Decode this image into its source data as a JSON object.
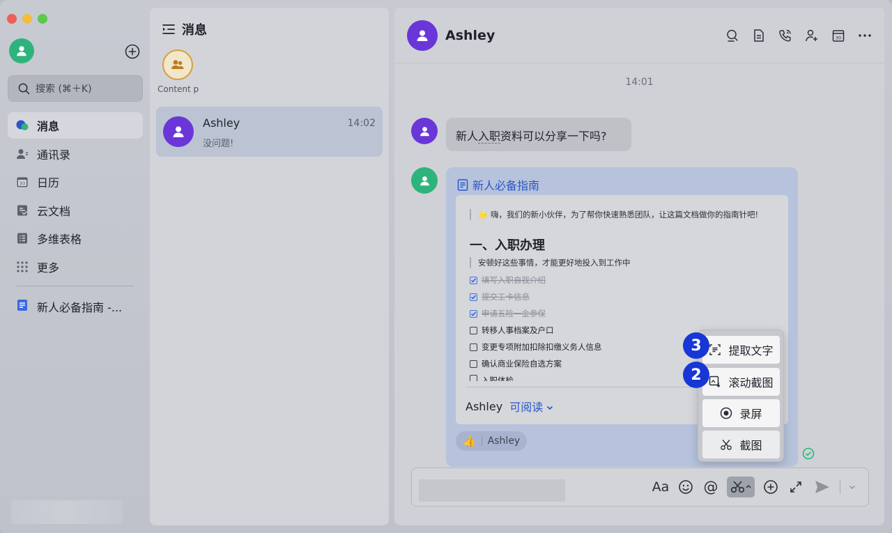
{
  "sidebar": {
    "search_placeholder": "搜索 (⌘＋K)",
    "nav": [
      {
        "label": "消息",
        "icon": "message-bubble-icon",
        "active": true
      },
      {
        "label": "通讯录",
        "icon": "contacts-icon",
        "active": false
      },
      {
        "label": "日历",
        "icon": "calendar-icon",
        "active": false
      },
      {
        "label": "云文档",
        "icon": "cloud-doc-icon",
        "active": false
      },
      {
        "label": "多维表格",
        "icon": "base-table-icon",
        "active": false
      },
      {
        "label": "更多",
        "icon": "grid-dots-icon",
        "active": false
      }
    ],
    "pinned_doc": "新人必备指南 -..."
  },
  "chat_list": {
    "title": "消息",
    "group_label": "Content p",
    "items": [
      {
        "name": "Ashley",
        "time": "14:02",
        "preview": "没问题!"
      }
    ]
  },
  "chat": {
    "title": "Ashley",
    "timestamp": "14:01",
    "message_prefix": "新人",
    "message_underlined": "入职",
    "message_suffix": "资料可以分享一下吗?",
    "card": {
      "title": "新人必备指南",
      "intro": "🌟 嗨，我们的新小伙伴，为了帮你快速熟悉团队，让这篇文档做你的指南针吧!",
      "heading": "一、入职办理",
      "subtitle": "安顿好这些事情，才能更好地投入到工作中",
      "todos": [
        {
          "text": "填写入职自我介绍",
          "done": true
        },
        {
          "text": "提交工卡信息",
          "done": true
        },
        {
          "text": "申请五险一金参保",
          "done": true
        },
        {
          "text": "转移人事档案及户口",
          "done": false
        },
        {
          "text": "变更专项附加扣除扣缴义务人信息",
          "done": false
        },
        {
          "text": "确认商业保险自选方案",
          "done": false
        },
        {
          "text": "入职体检",
          "done": false
        }
      ],
      "owner": "Ashley",
      "permission": "可阅读",
      "reaction_user": "Ashley"
    },
    "popup_menu": [
      {
        "label": "提取文字",
        "icon": "extract-text-icon",
        "step": "3"
      },
      {
        "label": "滚动截图",
        "icon": "scroll-screenshot-icon",
        "step": "2"
      },
      {
        "label": "录屏",
        "icon": "record-screen-icon",
        "step": ""
      },
      {
        "label": "截图",
        "icon": "scissors-icon",
        "step": ""
      }
    ],
    "toolbar": {
      "font_label": "Aa",
      "at_label": "@"
    }
  },
  "colors": {
    "accent_blue": "#2a56c8",
    "avatar_purple": "#6a36d8",
    "avatar_green": "#2fb37c",
    "step_badge": "#1636d6"
  }
}
